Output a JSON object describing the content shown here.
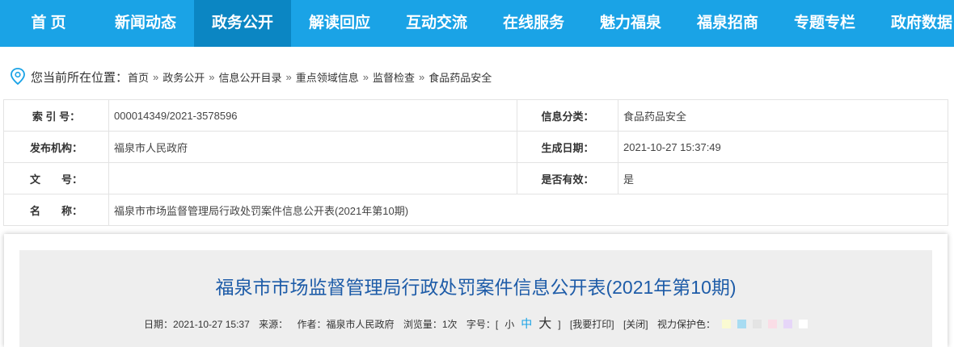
{
  "nav": {
    "items": [
      "首 页",
      "新闻动态",
      "政务公开",
      "解读回应",
      "互动交流",
      "在线服务",
      "魅力福泉",
      "福泉招商",
      "专题专栏",
      "政府数据"
    ]
  },
  "breadcrumb": {
    "prefix": "您当前所在位置：",
    "items": [
      "首页",
      "政务公开",
      "信息公开目录",
      "重点领域信息",
      "监督检查",
      "食品药品安全"
    ],
    "separator": "»"
  },
  "meta": {
    "index_label": "索 引 号：",
    "index_value": "000014349/2021-3578596",
    "category_label": "信息分类：",
    "category_value": "食品药品安全",
    "publisher_label": "发布机构：",
    "publisher_value": "福泉市人民政府",
    "date_label": "生成日期：",
    "date_value": "2021-10-27 15:37:49",
    "docno_label": "文　　号：",
    "docno_value": "",
    "valid_label": "是否有效：",
    "valid_value": "是",
    "name_label": "名　　称：",
    "name_value": "福泉市市场监督管理局行政处罚案件信息公开表(2021年第10期)"
  },
  "article": {
    "title": "福泉市市场监督管理局行政处罚案件信息公开表(2021年第10期)",
    "date": "日期：2021-10-27 15:37",
    "source": "来源：",
    "author": "作者：福泉市人民政府",
    "views": "浏览量：1次",
    "fontsize_label": "字号：[",
    "font_small": "小",
    "font_medium": "中",
    "font_large": "大",
    "bracket_close": "]",
    "print": "[我要打印]",
    "close": "[关闭]",
    "eye_label": "视力保护色："
  },
  "eye_colors": [
    "#fafad2",
    "#a8dcf2",
    "#e4e4e4",
    "#fadde6",
    "#e6d6f8",
    "#ffffff"
  ],
  "colors": {
    "nav_bg": "#1aa3e6",
    "nav_active": "#0b86c3",
    "title": "#1e5ca8"
  }
}
